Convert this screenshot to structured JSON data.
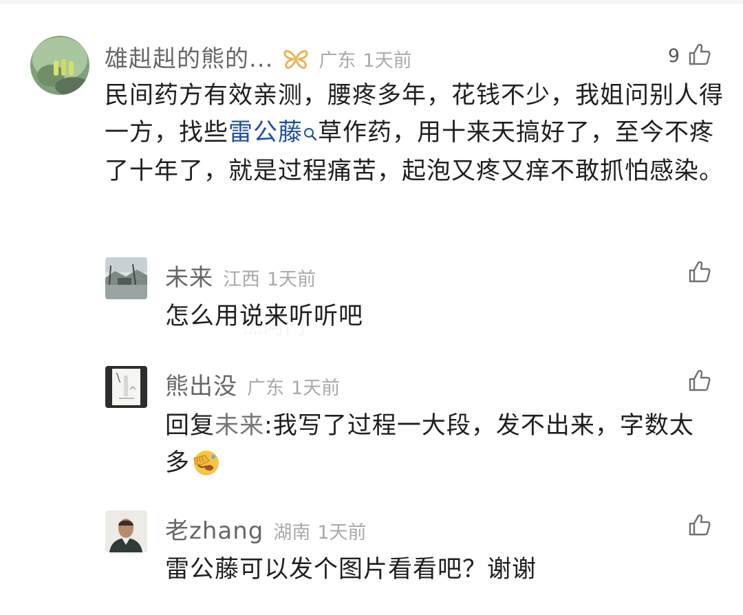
{
  "comments": [
    {
      "user": "雄赳赳的熊的...",
      "badge_icon": "butterfly-icon",
      "location": "广东",
      "time": "1天前",
      "likes": "9",
      "text_before": "民间药方有效亲测，腰疼多年，花钱不少，我姐问别人得一方，找些",
      "keyword": "雷公藤",
      "text_after": "草作药，用十来天搞好了，至今不疼了十年了，就是过程痛苦，起泡又疼又痒不敢抓怕感染。"
    }
  ],
  "replies": [
    {
      "user": "未来",
      "location": "江西",
      "time": "1天前",
      "text": "怎么用说来听听吧"
    },
    {
      "user": "熊出没",
      "location": "广东",
      "time": "1天前",
      "reply_prefix": "回复",
      "reply_to": "未来",
      "text": ":我写了过程一大段，发不出来，字数太多",
      "emoji": "facepalm-emoji"
    },
    {
      "user": "老zhang",
      "location": "湖南",
      "time": "1天前",
      "text": "雷公藤可以发个图片看看吧？谢谢"
    }
  ],
  "watermark": "杰阿门",
  "colors": {
    "keyword_link": "#1f4f9c",
    "badge": "#e8b455",
    "meta_gray": "#a9a9a9"
  }
}
